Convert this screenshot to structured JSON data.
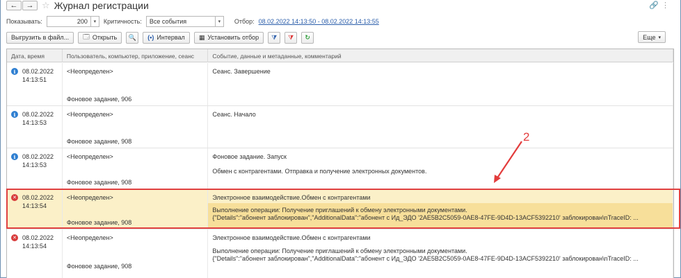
{
  "window": {
    "title": "Журнал регистрации",
    "back_icon": "arrow-left-icon",
    "forward_icon": "arrow-right-icon"
  },
  "filter": {
    "show_label": "Показывать:",
    "show_value": "200",
    "criticality_label": "Критичность:",
    "criticality_value": "Все события",
    "selection_label": "Отбор:",
    "selection_link": "08.02.2022 14:13:50 - 08.02.2022 14:13:55"
  },
  "toolbar": {
    "export_label": "Выгрузить в файл...",
    "open_label": "Открыть",
    "interval_label": "Интервал",
    "set_filter_label": "Установить отбор",
    "more_label": "Еще"
  },
  "table": {
    "columns": [
      "Дата, время",
      "Пользователь, компьютер, приложение, сеанс",
      "Событие, данные и метаданные, комментарий"
    ],
    "rows": [
      {
        "level": "info",
        "date": "08.02.2022",
        "time": "14:13:51",
        "user": "<Неопределен>",
        "job": "Фоновое задание, 906",
        "event": "Сеанс. Завершение",
        "comment1": "",
        "comment2": ""
      },
      {
        "level": "info",
        "date": "08.02.2022",
        "time": "14:13:53",
        "user": "<Неопределен>",
        "job": "Фоновое задание, 908",
        "event": "Сеанс. Начало",
        "comment1": "",
        "comment2": ""
      },
      {
        "level": "info",
        "date": "08.02.2022",
        "time": "14:13:53",
        "user": "<Неопределен>",
        "job": "Фоновое задание, 908",
        "event": "Фоновое задание. Запуск",
        "comment1": "Обмен с контрагентами. Отправка и получение электронных документов.",
        "comment2": ""
      },
      {
        "level": "error",
        "date": "08.02.2022",
        "time": "14:13:54",
        "user": "<Неопределен>",
        "job": "Фоновое задание, 908",
        "event": "Электронное взаимодействие.Обмен с контрагентами",
        "comment1": "Выполнение операции: Получение приглашений к обмену электронными документами.",
        "comment2": "{\"Details\":\"абонент заблокирован\",\"AdditionalData\":\"абонент с Ид_ЭДО '2AE5B2C5059-0AE8-47FE-9D4D-13ACF5392210' заблокирован\\nTraceID: ..."
      },
      {
        "level": "error",
        "date": "08.02.2022",
        "time": "14:13:54",
        "user": "<Неопределен>",
        "job": "Фоновое задание, 908",
        "event": "Электронное взаимодействие.Обмен с контрагентами",
        "comment1": "Выполнение операции: Получение приглашений к обмену электронными документами.",
        "comment2": "{\"Details\":\"абонент заблокирован\",\"AdditionalData\":\"абонент с Ид_ЭДО '2AE5B2C5059-0AE8-47FE-9D4D-13ACF5392210' заблокирован\\nTraceID: ..."
      }
    ]
  },
  "annotation": {
    "number": "2",
    "color": "#e33c3c"
  },
  "colors": {
    "selected_row": "#fbf0c8",
    "selected_highlight": "#f7df9a",
    "info_icon": "#2f7fd1",
    "error_icon": "#d83b3b",
    "link": "#2a5daa"
  }
}
